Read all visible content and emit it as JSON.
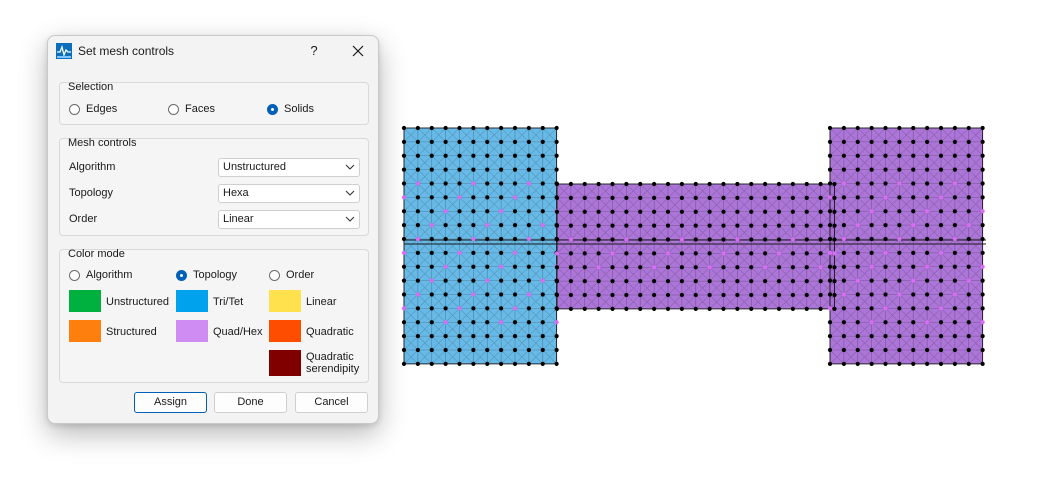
{
  "dialog": {
    "title": "Set mesh controls",
    "help_label": "?",
    "selection": {
      "label": "Selection",
      "options": [
        "Edges",
        "Faces",
        "Solids"
      ],
      "selected": "Solids"
    },
    "mesh_controls": {
      "label": "Mesh controls",
      "algorithm_label": "Algorithm",
      "algorithm_value": "Unstructured",
      "topology_label": "Topology",
      "topology_value": "Hexa",
      "order_label": "Order",
      "order_value": "Linear"
    },
    "color_mode": {
      "label": "Color mode",
      "options": [
        "Algorithm",
        "Topology",
        "Order"
      ],
      "selected": "Topology",
      "legend": {
        "unstructured": {
          "label": "Unstructured",
          "color": "#00b140"
        },
        "structured": {
          "label": "Structured",
          "color": "#ff7f0e"
        },
        "tri_tet": {
          "label": "Tri/Tet",
          "color": "#00a2ed"
        },
        "quad_hex": {
          "label": "Quad/Hex",
          "color": "#cf8cf2"
        },
        "linear": {
          "label": "Linear",
          "color": "#ffe14d"
        },
        "quadratic": {
          "label": "Quadratic",
          "color": "#ff4d00"
        },
        "quadratic_serendipity": {
          "label_line1": "Quadratic",
          "label_line2": "serendipity",
          "color": "#800000"
        }
      }
    },
    "buttons": {
      "assign": "Assign",
      "done": "Done",
      "cancel": "Cancel"
    }
  },
  "viewport": {
    "colors": {
      "tri_tet_region": "#5fb6e6",
      "quad_hex_region": "#a86ed6",
      "node": "#000000",
      "midside_node": "#d86cf2",
      "edge": "#1a1a1a"
    }
  }
}
